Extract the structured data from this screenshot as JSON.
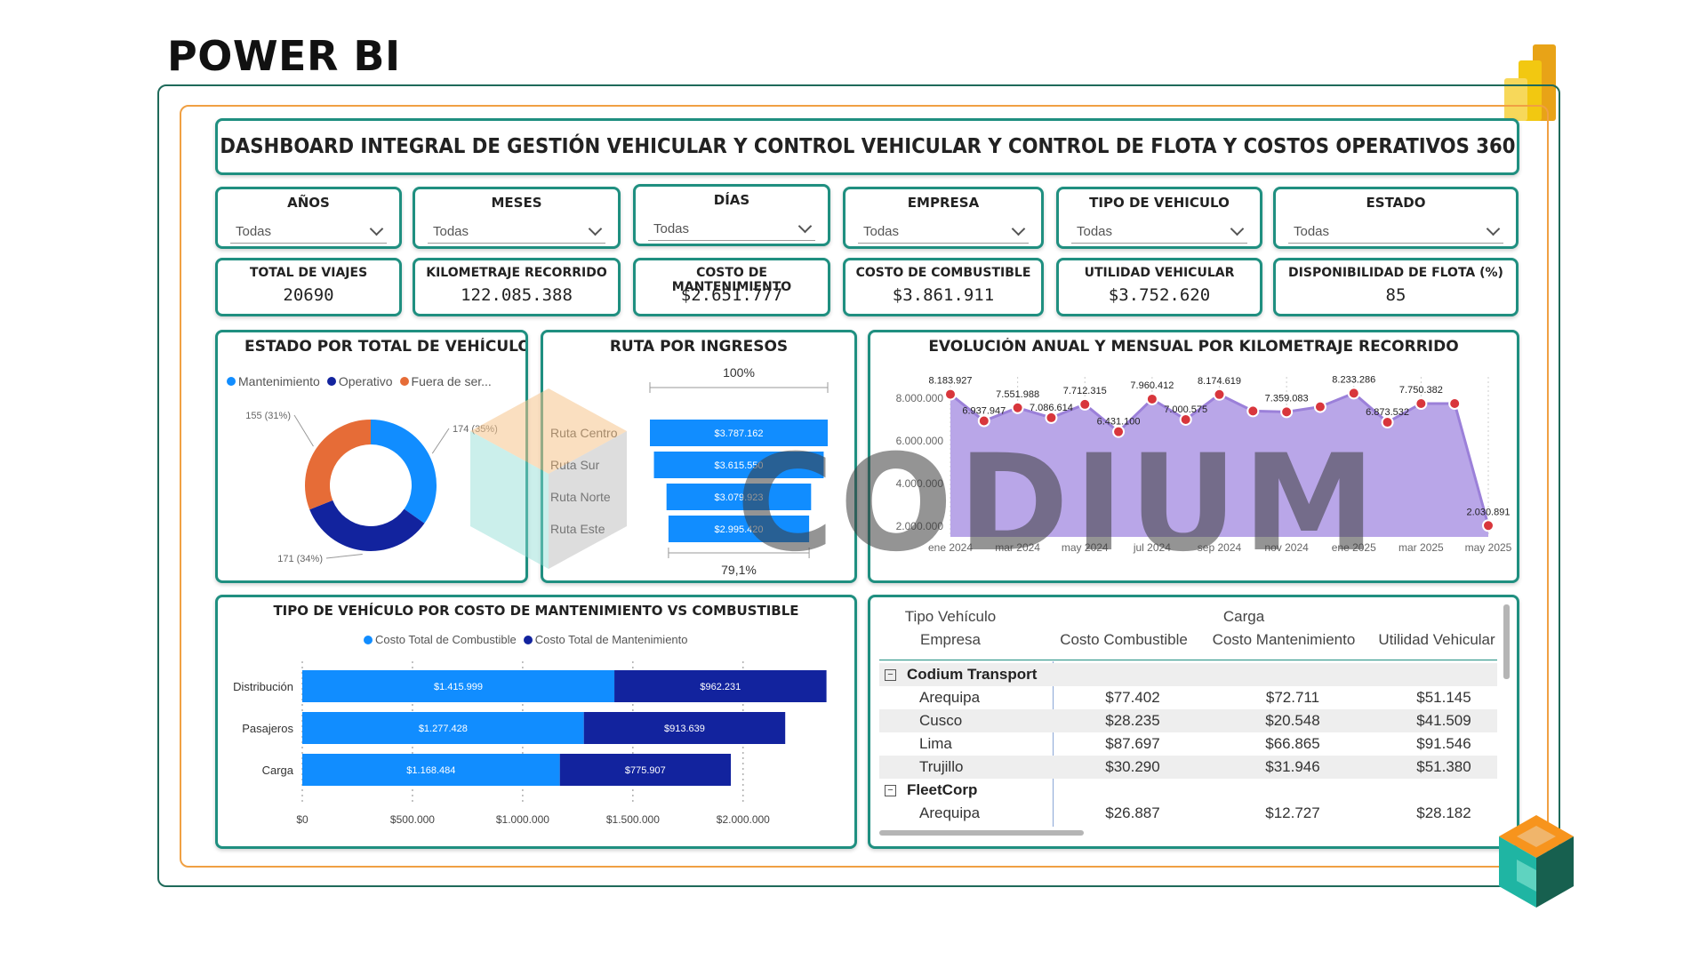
{
  "page": {
    "title": "POWER BI"
  },
  "banner": {
    "title": "DASHBOARD INTEGRAL DE GESTIÓN VEHICULAR Y CONTROL VEHICULAR Y CONTROL DE FLOTA Y COSTOS OPERATIVOS 360"
  },
  "slicers": [
    {
      "label": "AÑOS",
      "value": "Todas"
    },
    {
      "label": "MESES",
      "value": "Todas"
    },
    {
      "label": "DÍAS",
      "value": "Todas"
    },
    {
      "label": "EMPRESA",
      "value": "Todas"
    },
    {
      "label": "TIPO DE VEHICULO",
      "value": "Todas"
    },
    {
      "label": "ESTADO",
      "value": "Todas"
    }
  ],
  "kpis": [
    {
      "label": "TOTAL DE VIAJES",
      "value": "20690"
    },
    {
      "label": "KILOMETRAJE RECORRIDO",
      "value": "122.085.388"
    },
    {
      "label": "COSTO DE MANTENIMIENTO",
      "value": "$2.651.777"
    },
    {
      "label": "COSTO DE COMBUSTIBLE",
      "value": "$3.861.911"
    },
    {
      "label": "UTILIDAD VEHICULAR",
      "value": "$3.752.620"
    },
    {
      "label": "DISPONIBILIDAD DE FLOTA (%)",
      "value": "85"
    }
  ],
  "watermark": "CODIUM",
  "colors": {
    "teal": "#1f8f80",
    "orange": "#f0a043",
    "blue_light": "#118dff",
    "blue_dark": "#12239e",
    "orange_slice": "#e66c37",
    "area": "#b9a6e8",
    "marker": "#d8363c"
  },
  "chart_data": [
    {
      "type": "pie",
      "title": "ESTADO POR TOTAL DE VEHÍCULO",
      "legend": [
        "Mantenimiento",
        "Operativo",
        "Fuera de ser..."
      ],
      "series": [
        {
          "name": "Mantenimiento",
          "value": 174,
          "label": "174 (35%)",
          "color": "#118dff"
        },
        {
          "name": "Operativo",
          "value": 171,
          "label": "171 (34%)",
          "color": "#12239e"
        },
        {
          "name": "Fuera de servicio",
          "value": 155,
          "label": "155 (31%)",
          "color": "#e66c37"
        }
      ]
    },
    {
      "type": "bar",
      "subtype": "funnel",
      "title": "RUTA POR INGRESOS",
      "top_label": "100%",
      "bottom_label": "79,1%",
      "categories": [
        "Ruta Centro",
        "Ruta Sur",
        "Ruta Norte",
        "Ruta Este"
      ],
      "values": [
        3787162,
        3615550,
        3079923,
        2995420
      ],
      "labels": [
        "$3.787.162",
        "$3.615.550",
        "$3.079.923",
        "$2.995.420"
      ]
    },
    {
      "type": "area",
      "title": "EVOLUCIÓN ANUAL Y MENSUAL POR KILOMETRAJE RECORRIDO",
      "x_ticks": [
        "ene 2024",
        "mar 2024",
        "may 2024",
        "jul 2024",
        "sep 2024",
        "nov 2024",
        "ene 2025",
        "mar 2025",
        "may 2025"
      ],
      "y_ticks": [
        "2.000.000",
        "4.000.000",
        "6.000.000",
        "8.000.000"
      ],
      "ylim": [
        1500000,
        9000000
      ],
      "values": [
        8183927,
        6937947,
        7551988,
        7086614,
        7712315,
        6431100,
        7960412,
        7000575,
        8174619,
        7400000,
        7359083,
        7600000,
        8233286,
        6873532,
        7750382,
        7750382,
        2030891
      ],
      "labels": [
        "8.183.927",
        "6.937.947",
        "7.551.988",
        "7.086.614",
        "7.712.315",
        "6.431.100",
        "7.960.412",
        "7.000.575",
        "8.174.619",
        "",
        "7.359.083",
        "",
        "8.233.286",
        "6.873.532",
        "7.750.382",
        "",
        "2.030.891"
      ]
    },
    {
      "type": "bar",
      "subtype": "stacked-horizontal",
      "title": "TIPO DE VEHÍCULO POR COSTO DE MANTENIMIENTO VS COMBUSTIBLE",
      "categories": [
        "Distribución",
        "Pasajeros",
        "Carga"
      ],
      "series": [
        {
          "name": "Costo Total de Combustible",
          "values": [
            1415999,
            1277428,
            1168484
          ],
          "labels": [
            "$1.415.999",
            "$1.277.428",
            "$1.168.484"
          ]
        },
        {
          "name": "Costo Total de Mantenimiento",
          "values": [
            962231,
            913639,
            775907
          ],
          "labels": [
            "$962.231",
            "$913.639",
            "$775.907"
          ]
        }
      ],
      "x_ticks": [
        "$0",
        "$500.000",
        "$1.000.000",
        "$1.500.000",
        "$2.000.000"
      ],
      "xlim": [
        0,
        2400000
      ]
    }
  ],
  "matrix": {
    "row_header_1": "Tipo Vehículo",
    "row_header_2": "Empresa",
    "column_group": "Carga",
    "columns": [
      "Costo Combustible",
      "Costo Mantenimiento",
      "Utilidad Vehicular"
    ],
    "rows": [
      {
        "kind": "group",
        "label": "Codium Transport"
      },
      {
        "kind": "item",
        "label": "Arequipa",
        "values": [
          "$77.402",
          "$72.711",
          "$51.145"
        ]
      },
      {
        "kind": "item",
        "label": "Cusco",
        "values": [
          "$28.235",
          "$20.548",
          "$41.509"
        ]
      },
      {
        "kind": "item",
        "label": "Lima",
        "values": [
          "$87.697",
          "$66.865",
          "$91.546"
        ]
      },
      {
        "kind": "item",
        "label": "Trujillo",
        "values": [
          "$30.290",
          "$31.946",
          "$51.380"
        ]
      },
      {
        "kind": "group",
        "label": "FleetCorp"
      },
      {
        "kind": "item",
        "label": "Arequipa",
        "values": [
          "$26.887",
          "$12.727",
          "$28.182"
        ]
      }
    ]
  }
}
